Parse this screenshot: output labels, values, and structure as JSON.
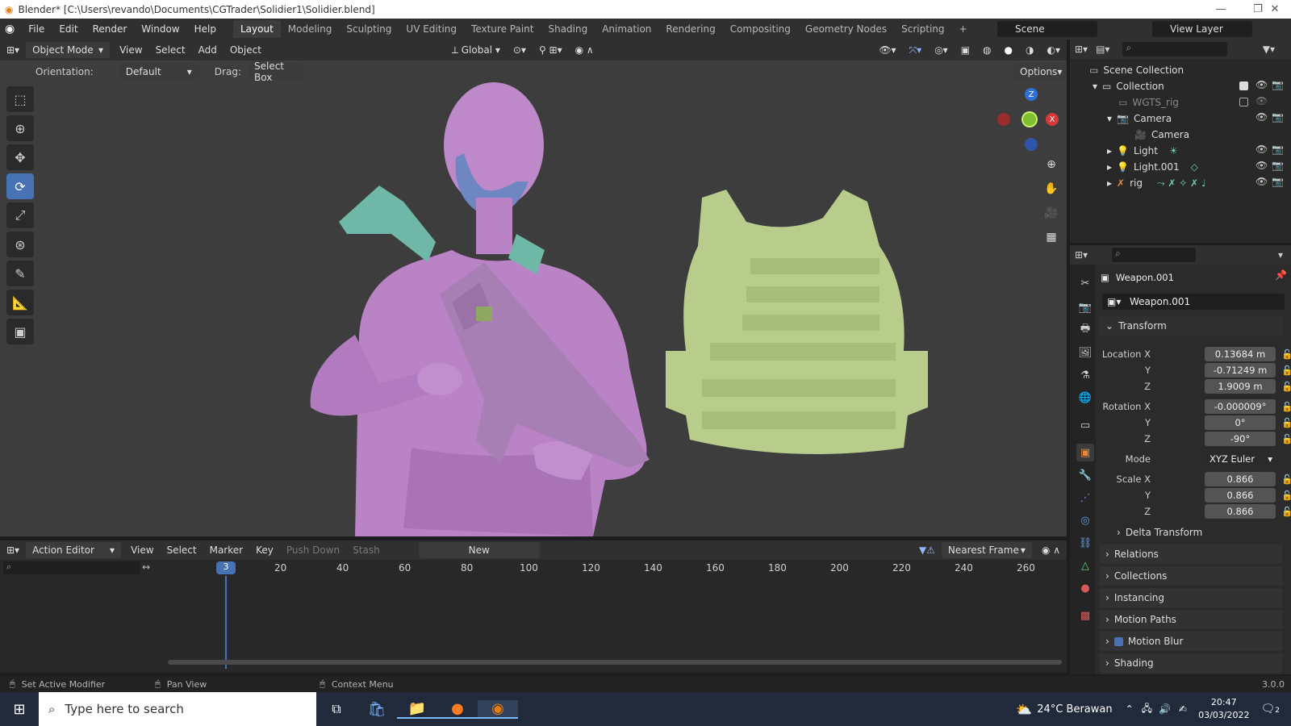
{
  "window": {
    "title": "Blender* [C:\\Users\\revando\\Documents\\CGTrader\\Solidier1\\Solidier.blend]",
    "minimize": "—",
    "maximize": "❐",
    "close": "✕"
  },
  "menus": [
    "File",
    "Edit",
    "Render",
    "Window",
    "Help"
  ],
  "workspaces": [
    "Layout",
    "Modeling",
    "Sculpting",
    "UV Editing",
    "Texture Paint",
    "Shading",
    "Animation",
    "Rendering",
    "Compositing",
    "Geometry Nodes",
    "Scripting"
  ],
  "add_workspace": "+",
  "scene": {
    "name": "Scene",
    "view_layer": "View Layer"
  },
  "viewport_header": {
    "mode": "Object Mode",
    "view": "View",
    "select": "Select",
    "add": "Add",
    "object": "Object",
    "transform_orientation": "Global"
  },
  "tool_settings": {
    "orientation_label": "Orientation:",
    "orientation": "Default",
    "drag_label": "Drag:",
    "drag": "Select Box",
    "options": "Options"
  },
  "gizmo": {
    "z": "Z",
    "x": "X"
  },
  "timeline": {
    "editor": "Action Editor",
    "view": "View",
    "select": "Select",
    "marker": "Marker",
    "key": "Key",
    "push_down": "Push Down",
    "stash": "Stash",
    "new": "New",
    "snap": "Nearest Frame",
    "current_frame": "3",
    "ticks": [
      "20",
      "40",
      "60",
      "80",
      "100",
      "120",
      "140",
      "160",
      "180",
      "200",
      "220",
      "240",
      "260"
    ]
  },
  "status_bar": {
    "left": "Set Active Modifier",
    "middle": "Pan View",
    "right": "Context Menu",
    "version": "3.0.0"
  },
  "outliner": {
    "scene_collection": "Scene Collection",
    "rows": [
      {
        "name": "Collection",
        "indent": 1
      },
      {
        "name": "WGTS_rig",
        "indent": 2
      },
      {
        "name": "Camera",
        "indent": 2
      },
      {
        "name": "Camera",
        "indent": 3
      },
      {
        "name": "Light",
        "indent": 2
      },
      {
        "name": "Light.001",
        "indent": 2
      },
      {
        "name": "rig",
        "indent": 2
      }
    ]
  },
  "properties": {
    "object_name": "Weapon.001",
    "object_field": "Weapon.001",
    "transform": "Transform",
    "location": {
      "label_x": "Location X",
      "x": "0.13684 m",
      "y": "-0.71249 m",
      "z": "1.9009 m"
    },
    "rotation": {
      "label_x": "Rotation X",
      "x": "-0.000009°",
      "y": "0°",
      "z": "-90°"
    },
    "mode_label": "Mode",
    "mode": "XYZ Euler",
    "scale": {
      "label_x": "Scale X",
      "x": "0.866",
      "y": "0.866",
      "z": "0.866"
    },
    "axis_y": "Y",
    "axis_z": "Z",
    "panels": [
      "Delta Transform",
      "Relations",
      "Collections",
      "Instancing",
      "Motion Paths",
      "Motion Blur",
      "Shading"
    ]
  },
  "taskbar": {
    "search_placeholder": "Type here to search",
    "weather": "24°C  Berawan",
    "time": "20:47",
    "date": "03/03/2022",
    "notifications": "2"
  },
  "colors": {
    "accent": "#4772b3",
    "character": "#b983c6",
    "vest": "#b8cc8c",
    "rifle_stock": "#6fb7a6"
  }
}
